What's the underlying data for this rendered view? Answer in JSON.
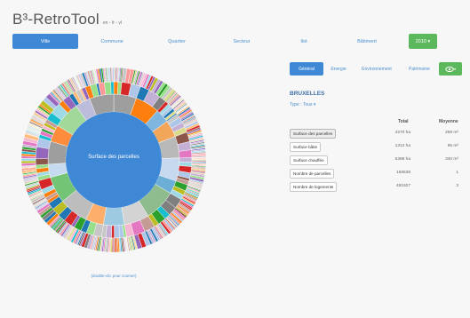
{
  "header": {
    "title": "B³-RetroTool",
    "langs": "en - fr - vl"
  },
  "nav": {
    "items": [
      "Ville",
      "Commune",
      "Quartier",
      "Secteur",
      "Ilot",
      "Bâtiment"
    ],
    "active": 0,
    "year": "2010 ▾"
  },
  "sunburst": {
    "center_label": "Surface des parcelles",
    "zoom_hint": "(double-clic pour zoomer)",
    "center_color": "#3f88d6"
  },
  "panel": {
    "tabs": [
      "Général",
      "Energie",
      "Environnement",
      "Patrimoine"
    ],
    "active_tab": 0,
    "eye_icon": "eye-icon",
    "region": "BRUXELLES",
    "type_label": "Type :",
    "type_value": "Tous ▾",
    "col_total": "Total",
    "col_avg": "Moyenne",
    "rows": [
      {
        "metric": "Surface des parcelles",
        "total": "4270 ha",
        "avg": "269 m²"
      },
      {
        "metric": "Surface bâtie",
        "total": "1312 ha",
        "avg": "95 m²"
      },
      {
        "metric": "Surface chauffée",
        "total": "5388 ha",
        "avg": "340 m²"
      },
      {
        "metric": "Nombre de parcelles",
        "total": "158638",
        "avg": "1"
      },
      {
        "metric": "Nombre de logements",
        "total": "491927",
        "avg": "3"
      }
    ],
    "selected_row": 0
  },
  "colors": {
    "accent": "#3f88d6",
    "green": "#5cb85c",
    "link": "#4a8fcf"
  }
}
